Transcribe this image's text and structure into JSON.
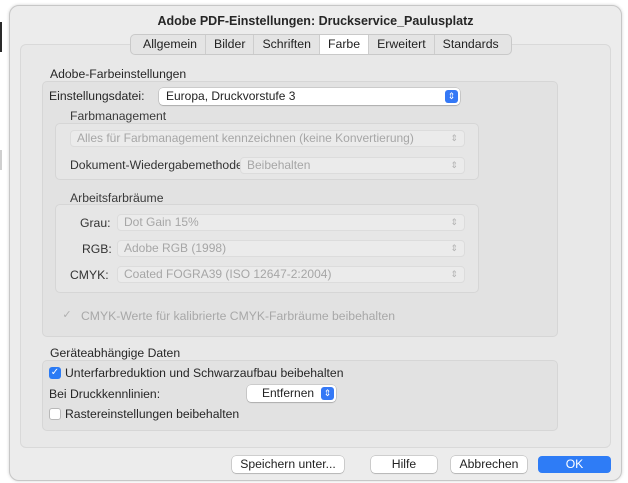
{
  "window": {
    "title": "Adobe PDF-Einstellungen: Druckservice_Paulusplatz"
  },
  "tabs": [
    "Allgemein",
    "Bilder",
    "Schriften",
    "Farbe",
    "Erweitert",
    "Standards"
  ],
  "active_tab": "Farbe",
  "color_settings": {
    "heading": "Adobe-Farbeinstellungen",
    "settings_file_label": "Einstellungsdatei:",
    "settings_file_value": "Europa, Druckvorstufe 3",
    "color_management": {
      "heading": "Farbmanagement",
      "policy_value": "Alles für Farbmanagement kennzeichnen (keine Konvertierung)",
      "intent_label": "Dokument-Wiedergabemethode:",
      "intent_value": "Beibehalten"
    },
    "working_spaces": {
      "heading": "Arbeitsfarbräume",
      "gray_label": "Grau:",
      "gray_value": "Dot Gain 15%",
      "rgb_label": "RGB:",
      "rgb_value": "Adobe RGB (1998)",
      "cmyk_label": "CMYK:",
      "cmyk_value": "Coated FOGRA39 (ISO 12647-2:2004)"
    },
    "preserve_cmyk_label": "CMYK-Werte für kalibrierte CMYK-Farbräume beibehalten",
    "preserve_cmyk_checked": true
  },
  "device_data": {
    "heading": "Geräteabhängige Daten",
    "ucr_label": "Unterfarbreduktion und Schwarzaufbau beibehalten",
    "ucr_checked": true,
    "transfer_label": "Bei Druckkennlinien:",
    "transfer_value": "Entfernen",
    "halftone_label": "Rastereinstellungen beibehalten",
    "halftone_checked": false
  },
  "buttons": {
    "save_as": "Speichern unter...",
    "help": "Hilfe",
    "cancel": "Abbrechen",
    "ok": "OK"
  },
  "colors": {
    "accent": "#2e7cf6",
    "window_bg": "#ececec"
  },
  "icons": {
    "popup_arrows": "updown-chevron",
    "checkmark": "✓"
  }
}
